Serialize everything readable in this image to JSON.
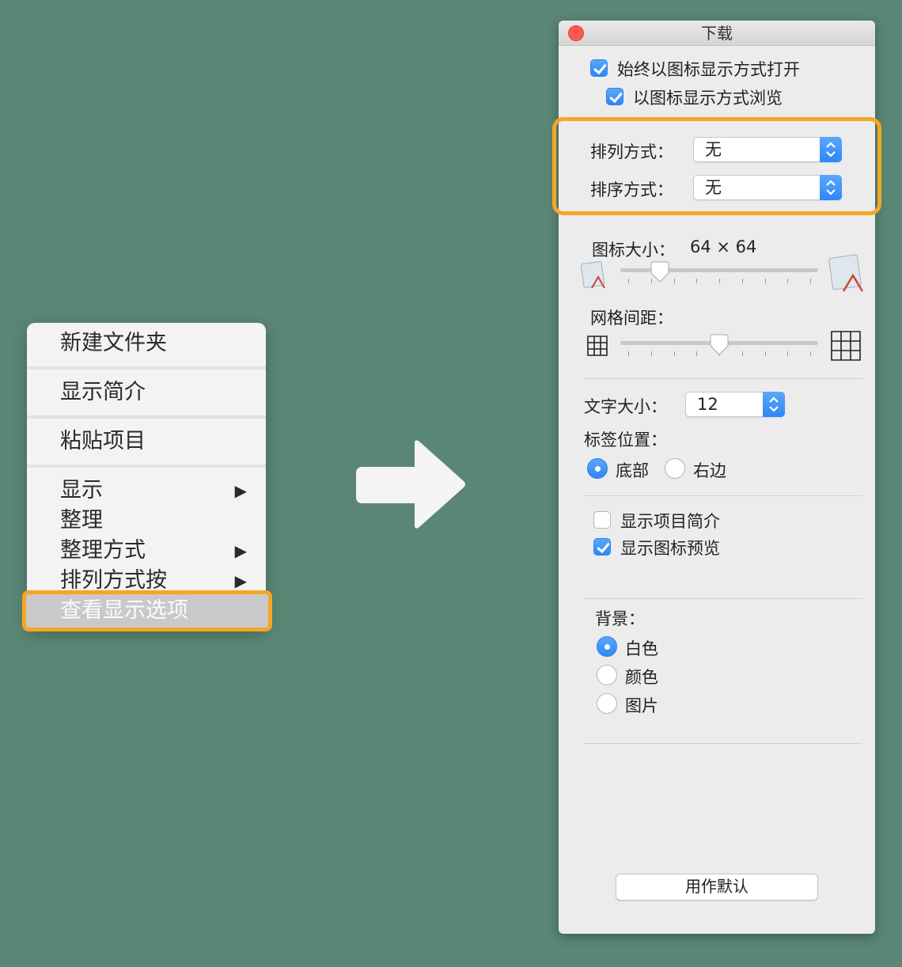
{
  "context_menu": {
    "items": [
      {
        "label": "新建文件夹"
      },
      {
        "label": "显示简介"
      },
      {
        "label": "粘贴项目"
      },
      {
        "label": "显示",
        "submenu": true
      },
      {
        "label": "整理"
      },
      {
        "label": "整理方式",
        "submenu": true
      },
      {
        "label": "排列方式按",
        "submenu": true
      },
      {
        "label": "查看显示选项",
        "selected": true
      }
    ],
    "submenu_glyph": "▶"
  },
  "dialog": {
    "title": "下载",
    "always_open_label": "始终以图标显示方式打开",
    "browse_label": "以图标显示方式浏览",
    "arrange_label": "排列方式：",
    "arrange_value": "无",
    "sort_label": "排序方式：",
    "sort_value": "无",
    "icon_size_label": "图标大小：",
    "icon_size_value": "64 × 64",
    "icon_size_level": 0.2,
    "grid_spacing_label": "网格间距：",
    "grid_spacing_level": 0.5,
    "text_size_label": "文字大小：",
    "text_size_value": "12",
    "label_position_label": "标签位置：",
    "label_bottom": "底部",
    "label_right": "右边",
    "show_item_info": "显示项目简介",
    "show_icon_preview": "显示图标预览",
    "background_label": "背景：",
    "bg_white": "白色",
    "bg_color": "颜色",
    "bg_picture": "图片",
    "default_button": "用作默认"
  },
  "colors": {
    "background": "#5a8675",
    "highlight": "#f5a623",
    "accent": "#2f86f6"
  },
  "icons": [
    "close-icon",
    "stepper-icon",
    "app-icon-small",
    "app-icon-large",
    "grid-small-icon",
    "grid-large-icon",
    "arrow-right-icon"
  ]
}
